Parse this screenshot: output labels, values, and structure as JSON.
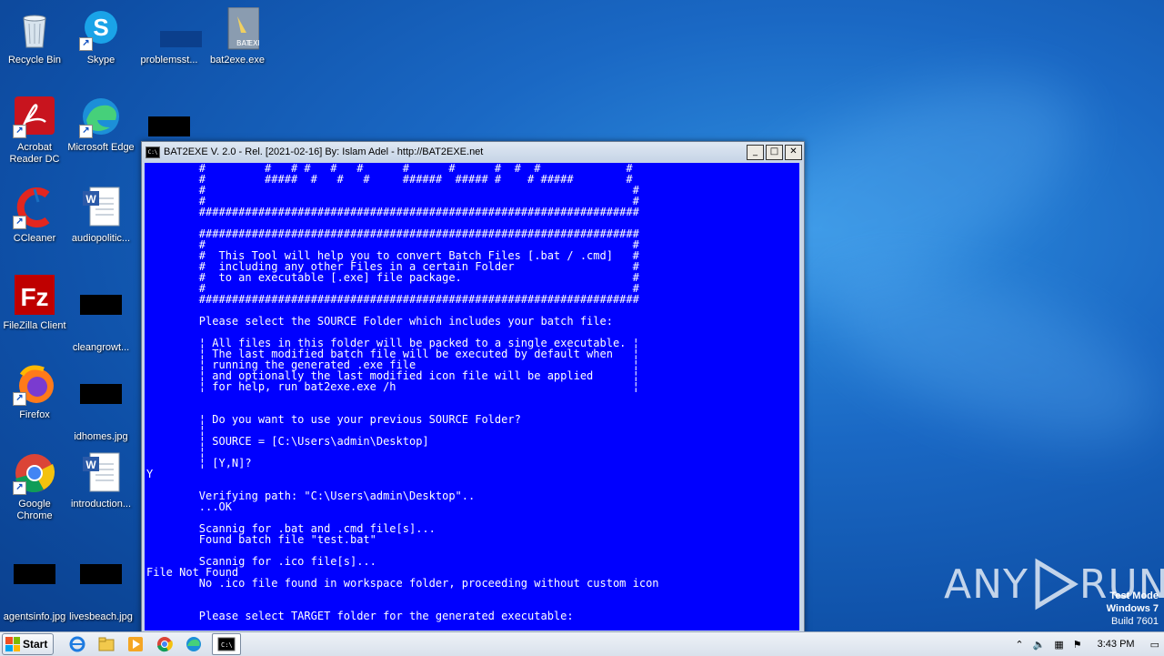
{
  "desktop": {
    "icons": [
      {
        "label": "Recycle Bin"
      },
      {
        "label": "Skype"
      },
      {
        "label": "problemsst..."
      },
      {
        "label": "bat2exe.exe"
      },
      {
        "label": "Acrobat Reader DC"
      },
      {
        "label": "Microsoft Edge"
      },
      {
        "label": "CCleaner"
      },
      {
        "label": "audiopolitic..."
      },
      {
        "label": "FileZilla Client"
      },
      {
        "label": "cleangrowt..."
      },
      {
        "label": "Firefox"
      },
      {
        "label": "idhomes.jpg"
      },
      {
        "label": "Google Chrome"
      },
      {
        "label": "introduction..."
      },
      {
        "label": "agentsinfo.jpg"
      },
      {
        "label": "livesbeach.jpg"
      }
    ]
  },
  "window": {
    "title": "BAT2EXE V. 2.0 - Rel. [2021-02-16] By: Islam Adel - http://BAT2EXE.net",
    "icon_text": "C:\\"
  },
  "console": {
    "lines": [
      "        #         #   # #   #   #      #      #      #  #  #             #",
      "        #         #####  #   #   #     ######  ##### #    # #####        #",
      "        #                                                                 #",
      "        #                                                                 #",
      "        ###################################################################",
      "",
      "        ###################################################################",
      "        #                                                                 #",
      "        #  This Tool will help you to convert Batch Files [.bat / .cmd]   #",
      "        #  including any other Files in a certain Folder                  #",
      "        #  to an executable [.exe] file package.                          #",
      "        #                                                                 #",
      "        ###################################################################",
      "",
      "        Please select the SOURCE Folder which includes your batch file:",
      "",
      "        ¦ All files in this folder will be packed to a single executable. ¦",
      "        ¦ The last modified batch file will be executed by default when   ¦",
      "        ¦ running the generated .exe file                                 ¦",
      "        ¦ and optionally the last modified icon file will be applied      ¦",
      "        ¦ for help, run bat2exe.exe /h                                    ¦",
      "",
      "",
      "        ¦ Do you want to use your previous SOURCE Folder?",
      "        ¦",
      "        ¦ SOURCE = [C:\\Users\\admin\\Desktop]",
      "        ¦",
      "        ¦ [Y,N]?",
      "Y",
      "",
      "        Verifying path: \"C:\\Users\\admin\\Desktop\"..",
      "        ...OK",
      "",
      "        Scannig for .bat and .cmd file[s]...",
      "        Found batch file \"test.bat\"",
      "",
      "        Scannig for .ico file[s]...",
      "File Not Found",
      "        No .ico file found in workspace folder, proceeding without custom icon",
      "",
      "",
      "        Please select TARGET folder for the generated executable:"
    ]
  },
  "taskbar": {
    "start_label": "Start",
    "clock": "3:43 PM"
  },
  "watermark": {
    "brand": "ANY",
    "brand2": "RUN",
    "test_mode": "Test Mode",
    "os": "Windows 7",
    "build": "Build 7601"
  }
}
